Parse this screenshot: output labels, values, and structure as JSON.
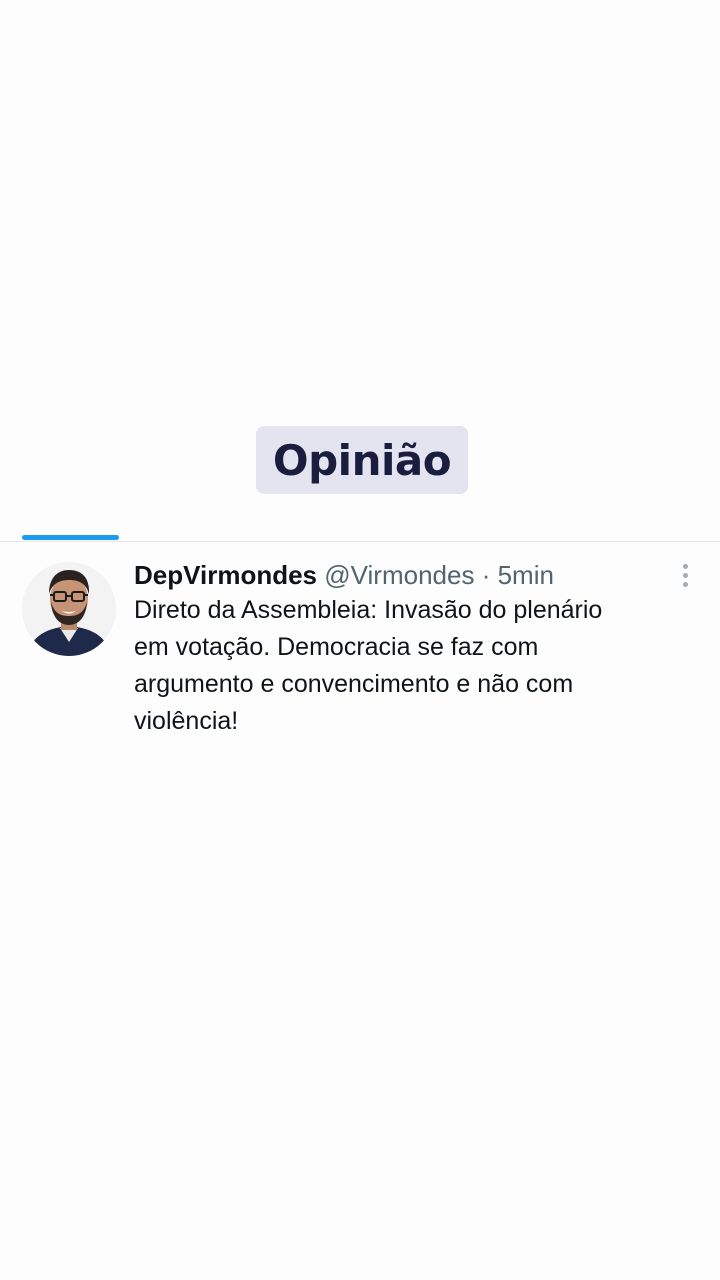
{
  "overlay": {
    "label": "Opinião"
  },
  "tweet": {
    "author_name": "DepVirmondes",
    "author_handle": "@Virmondes",
    "separator": "·",
    "time": "5min",
    "text_lines": [
      "Direto da Assembleia: Invasão do plenário",
      "em votação. Democracia se faz com",
      "argumento e convencimento e não com",
      "violência!"
    ]
  },
  "colors": {
    "tab_indicator": "#1d9bf0",
    "badge_background": "#e4e3f0",
    "badge_text": "#1a1d3d",
    "name_text": "#0f1419",
    "secondary_text": "#536471"
  },
  "icons": {
    "more": "more-vertical-icon",
    "avatar": "profile-avatar"
  }
}
